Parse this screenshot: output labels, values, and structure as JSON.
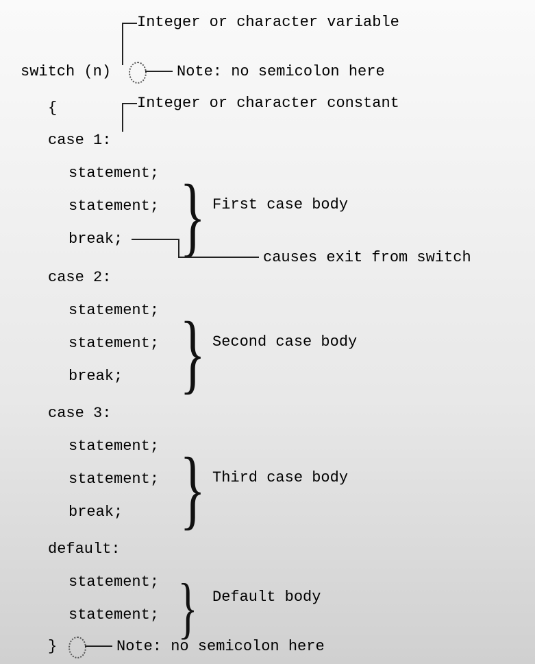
{
  "top_label": "Integer or character variable",
  "switch_line": "switch (n)",
  "no_semicolon": "Note: no semicolon here",
  "open_brace": "{",
  "const_label": "Integer or character constant",
  "case1": "case 1:",
  "stmt": "statement;",
  "break": "break;",
  "first_body": "First case body",
  "exit_label": "causes exit from switch",
  "case2": "case 2:",
  "second_body": "Second case body",
  "case3": "case 3:",
  "third_body": "Third case body",
  "default": "default:",
  "default_body": "Default body",
  "close_brace": "}",
  "bottom_note": "Note: no semicolon here"
}
